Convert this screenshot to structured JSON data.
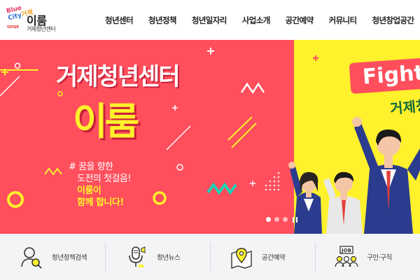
{
  "header": {
    "logo": {
      "script_line": [
        "Blue",
        "City",
        "거제"
      ],
      "sub": "GEOJE",
      "name": "이룸",
      "under": "거제청년센터"
    },
    "nav": [
      {
        "label": "청년센터"
      },
      {
        "label": "청년정책"
      },
      {
        "label": "청년일자리"
      },
      {
        "label": "사업소개"
      },
      {
        "label": "공간예약"
      },
      {
        "label": "커뮤니티"
      },
      {
        "label": "청년창업공간"
      }
    ]
  },
  "hero": {
    "title": "거제청년센터",
    "name": "이룸",
    "tagline": [
      "# 꿈을 향한",
      "도전의 첫걸음!",
      "이룸이",
      "함께 합니다!"
    ],
    "sign": "Fight",
    "sign_sub": "거제청",
    "slider": {
      "total": 3,
      "active": 1
    }
  },
  "quick_menu": [
    {
      "label": "청년정책검색",
      "icon": "person-search-icon"
    },
    {
      "label": "청년뉴스",
      "icon": "microphone-icon"
    },
    {
      "label": "공간예약",
      "icon": "map-pin-icon"
    },
    {
      "label": "구인·구직",
      "icon": "job-people-icon"
    }
  ],
  "colors": {
    "hero_red": "#ff4e5c",
    "hero_yellow": "#fff12b",
    "accent_green": "#136a3d",
    "quick_bg": "#f3f4f6"
  }
}
